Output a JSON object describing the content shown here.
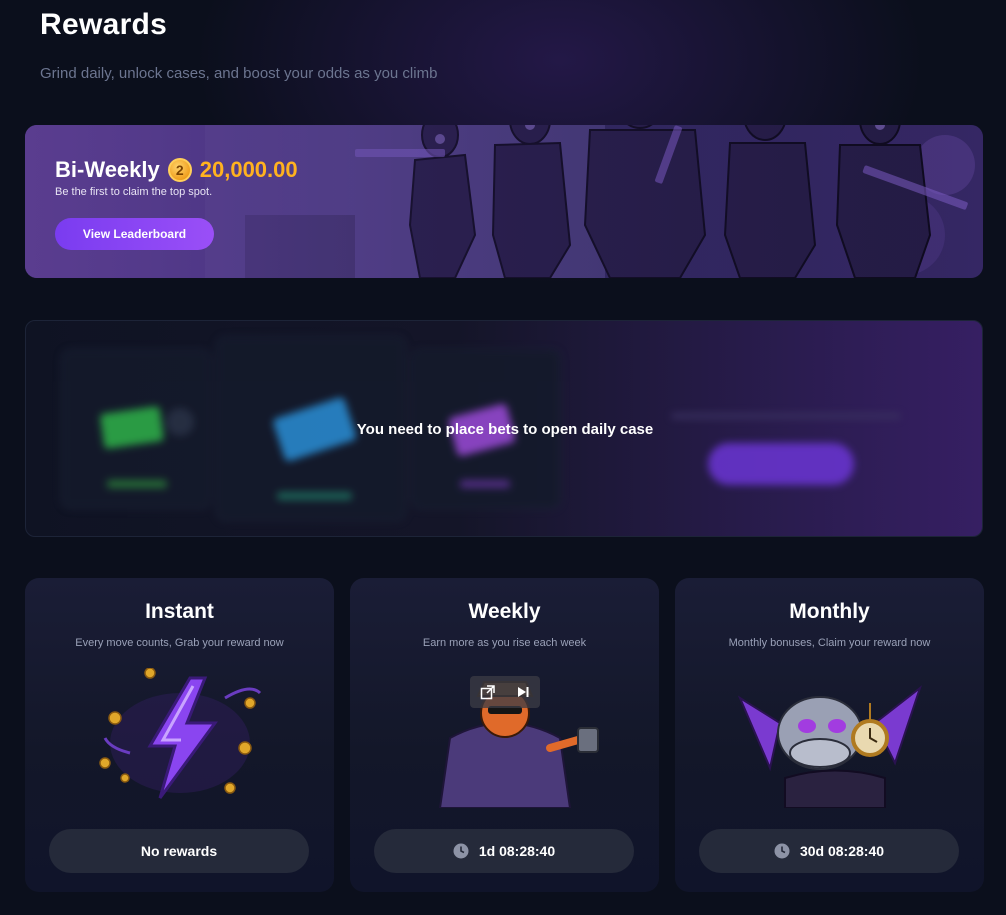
{
  "page": {
    "title": "Rewards",
    "subtitle": "Grind daily, unlock cases, and boost your odds as you climb"
  },
  "hero": {
    "title": "Bi-Weekly",
    "coin_icon": "coin-icon",
    "amount": "20,000.00",
    "tagline": "Be the first to claim the top spot.",
    "button_label": "View Leaderboard",
    "accent_color": "#8a45f5",
    "amount_color": "#ffb21f"
  },
  "daily_case": {
    "locked_message": "You need to place bets to open daily case"
  },
  "reward_cards": [
    {
      "title": "Instant",
      "description": "Every move counts, Grab your reward now",
      "status": "No rewards",
      "icon": "lightning-bolt-icon"
    },
    {
      "title": "Weekly",
      "description": "Earn more as you rise each week",
      "status": "1d 08:28:40",
      "icon": "clock-icon"
    },
    {
      "title": "Monthly",
      "description": "Monthly bonuses, Claim your reward now",
      "status": "30d 08:28:40",
      "icon": "clock-icon"
    }
  ],
  "colors": {
    "background": "#0b0f1c",
    "card": "#131729",
    "pill": "#252a3a",
    "purple": "#7a3cf0"
  }
}
